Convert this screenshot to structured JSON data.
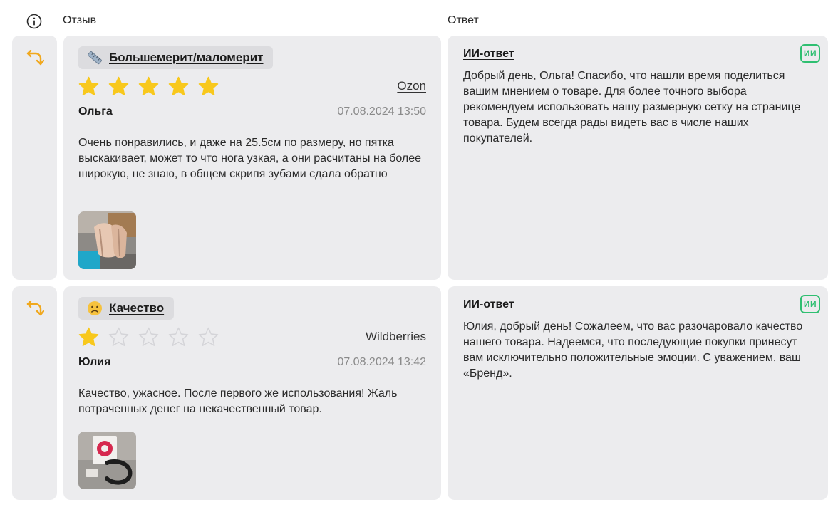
{
  "header": {
    "info_icon": "info-circle-icon",
    "review_label": "Отзыв",
    "answer_label": "Ответ"
  },
  "colors": {
    "panel_bg": "#ececee",
    "tag_bg": "#dcdcdf",
    "star_filled": "#f8c81c",
    "star_empty": "#d4d4d8",
    "reply_icon": "#f0a81e",
    "ai_badge": "#2fbf71"
  },
  "reviews": [
    {
      "tag": {
        "icon": "ruler-icon",
        "label": "Большемерит/маломерит"
      },
      "rating": 5,
      "rating_max": 5,
      "platform": "Ozon",
      "author": "Ольга",
      "date": "07.08.2024 13:50",
      "text": "Очень понравились, и даже на 25.5см по размеру, но пятка выскакивает, может то что нога узкая, а они расчитаны на более широкую, не знаю, в общем скрипя зубами сдала обратно",
      "photo": "shoes-photo",
      "answer": {
        "title": "ИИ-ответ",
        "badge": "ИИ",
        "text": "Добрый день, Ольга! Спасибо, что нашли время поделиться вашим мнением о товаре. Для более точного выбора рекомендуем использовать нашу размерную сетку на странице товара. Будем всегда рады видеть вас в числе наших покупателей."
      }
    },
    {
      "tag": {
        "icon": "sad-face-icon",
        "label": "Качество"
      },
      "rating": 1,
      "rating_max": 5,
      "platform": "Wildberries",
      "author": "Юлия",
      "date": "07.08.2024 13:42",
      "text": "Качество, ужасное. После первого же использования! Жаль потраченных денег на некачественный товар.",
      "photo": "product-photo",
      "answer": {
        "title": "ИИ-ответ",
        "badge": "ИИ",
        "text": "Юлия, добрый день! Сожалеем, что вас разочаровало качество нашего товара. Надеемся, что последующие покупки принесут вам исключительно положительные эмоции. С уважением, ваш «Бренд»."
      }
    }
  ]
}
